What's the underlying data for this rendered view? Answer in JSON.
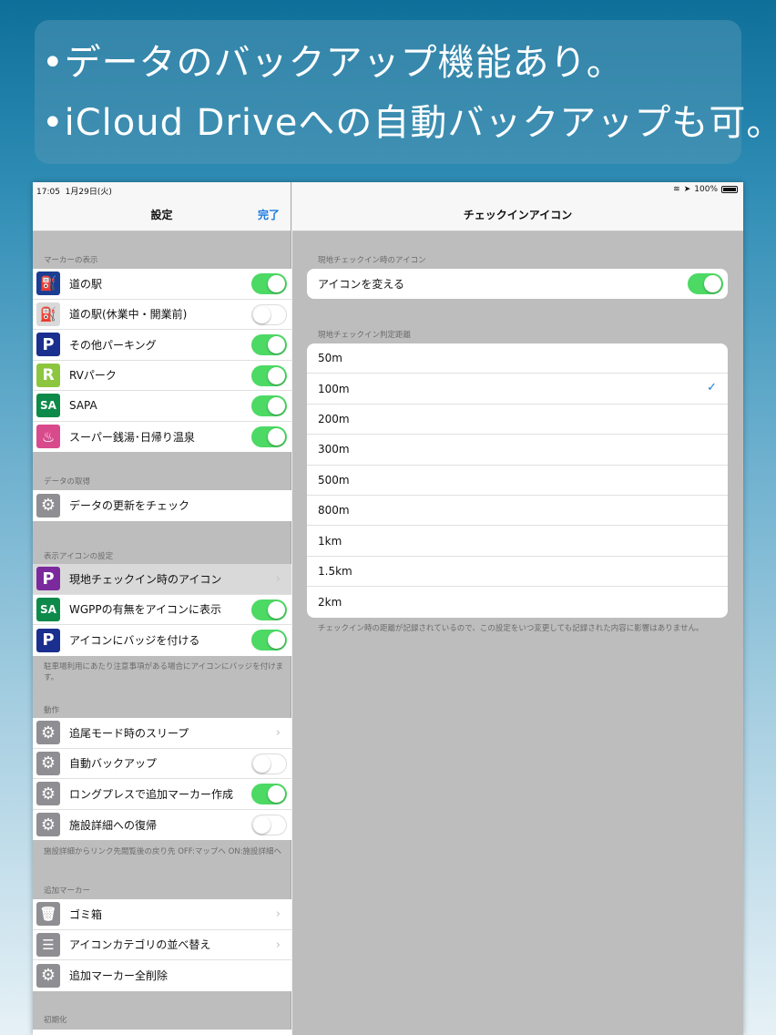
{
  "banner": {
    "line1": "•データのバックアップ機能あり。",
    "line2": "•iCloud Driveへの自動バックアップも可。"
  },
  "status": {
    "time": "17:05",
    "date": "1月29日(火)",
    "battery": "100%"
  },
  "master": {
    "title": "設定",
    "done": "完了",
    "sec1": "マーカーの表示",
    "markers": [
      {
        "label": "道の駅",
        "icon": "michi-no-eki-icon",
        "on": true
      },
      {
        "label": "道の駅(休業中・開業前)",
        "icon": "michi-no-eki-closed-icon",
        "on": false
      },
      {
        "label": "その他パーキング",
        "icon": "parking-icon",
        "on": true
      },
      {
        "label": "RVパーク",
        "icon": "rv-park-icon",
        "on": true
      },
      {
        "label": "SAPA",
        "icon": "sapa-icon",
        "on": true
      },
      {
        "label": "スーパー銭湯･日帰り温泉",
        "icon": "onsen-icon",
        "on": true
      }
    ],
    "sec2": "データの取得",
    "update": "データの更新をチェック",
    "sec3": "表示アイコンの設定",
    "icons": [
      {
        "label": "現地チェックイン時のアイコン"
      },
      {
        "label": "WGPPの有無をアイコンに表示"
      },
      {
        "label": "アイコンにバッジを付ける"
      }
    ],
    "foot3": "駐車場利用にあたり注意事項がある場合にアイコンにバッジを付けます。",
    "sec4": "動作",
    "actions": [
      {
        "label": "追尾モード時のスリープ"
      },
      {
        "label": "自動バックアップ"
      },
      {
        "label": "ロングプレスで追加マーカー作成"
      },
      {
        "label": "施設詳細への復帰"
      }
    ],
    "foot4": "施設詳細からリンク先閲覧後の戻り先 OFF:マップへ ON:施設詳細へ",
    "sec5": "追加マーカー",
    "extra": [
      {
        "label": "ゴミ箱"
      },
      {
        "label": "アイコンカテゴリの並べ替え"
      },
      {
        "label": "追加マーカー全削除"
      }
    ],
    "sec6": "初期化"
  },
  "detail": {
    "title": "チェックインアイコン",
    "header1": "現地チェックイン時のアイコン",
    "change_icon": "アイコンを変える",
    "header2": "現地チェックイン判定距離",
    "distances": [
      "50m",
      "100m",
      "200m",
      "300m",
      "500m",
      "800m",
      "1km",
      "1.5km",
      "2km"
    ],
    "selected": "100m",
    "footer": "チェックイン時の距離が記録されているので、この設定をいつ変更しても記録された内容に影響はありません。"
  },
  "colors": {
    "toggle_on": "#4cd964",
    "tint": "#1a7ae0"
  }
}
